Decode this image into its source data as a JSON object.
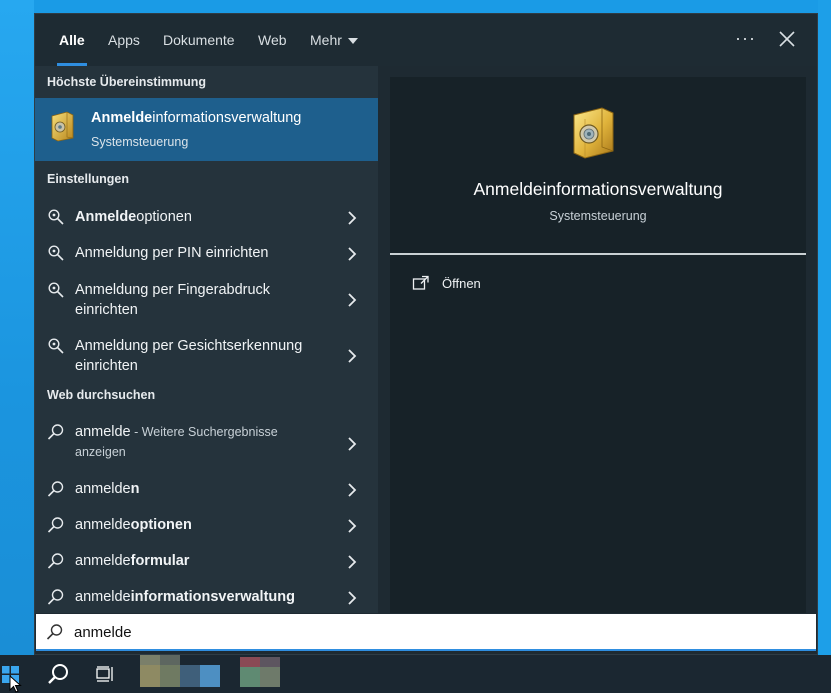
{
  "tabs": [
    {
      "label": "Alle",
      "active": true
    },
    {
      "label": "Apps",
      "active": false
    },
    {
      "label": "Dokumente",
      "active": false
    },
    {
      "label": "Web",
      "active": false
    },
    {
      "label": "Mehr",
      "active": false
    }
  ],
  "header": {
    "more_options": "···"
  },
  "sections": {
    "best_match": "Höchste Übereinstimmung",
    "settings": "Einstellungen",
    "web": "Web durchsuchen"
  },
  "best_match": {
    "title_bold": "Anmelde",
    "title_rest": "informationsverwaltung",
    "subtitle": "Systemsteuerung"
  },
  "settings_items": [
    {
      "bold": "Anmelde",
      "rest": "optionen"
    },
    {
      "bold": "",
      "rest": "Anmeldung per PIN einrichten"
    },
    {
      "bold": "",
      "rest": "Anmeldung per Fingerabdruck",
      "line2": "einrichten"
    },
    {
      "bold": "",
      "rest": "Anmeldung per Gesichtserkennung",
      "line2": "einrichten"
    }
  ],
  "web_items": [
    {
      "plain": "anmelde",
      "suffix": " - Weitere Suchergebnisse",
      "line2": "anzeigen"
    },
    {
      "plain": "anmelde",
      "bold": "n"
    },
    {
      "plain": "anmelde",
      "bold": "optionen"
    },
    {
      "plain": "anmelde",
      "bold": "formular"
    },
    {
      "plain": "anmelde",
      "bold": "informationsverwaltung"
    }
  ],
  "preview": {
    "title": "Anmeldeinformationsverwaltung",
    "subtitle": "Systemsteuerung",
    "action_open": "Öffnen"
  },
  "search": {
    "value": "anmelde"
  },
  "colors": {
    "accent": "#2f8ee0",
    "selected_bg": "#1e5f8d",
    "panel_bg": "#25333c",
    "preview_bg": "#172228",
    "desktop": "#1a9be6"
  }
}
